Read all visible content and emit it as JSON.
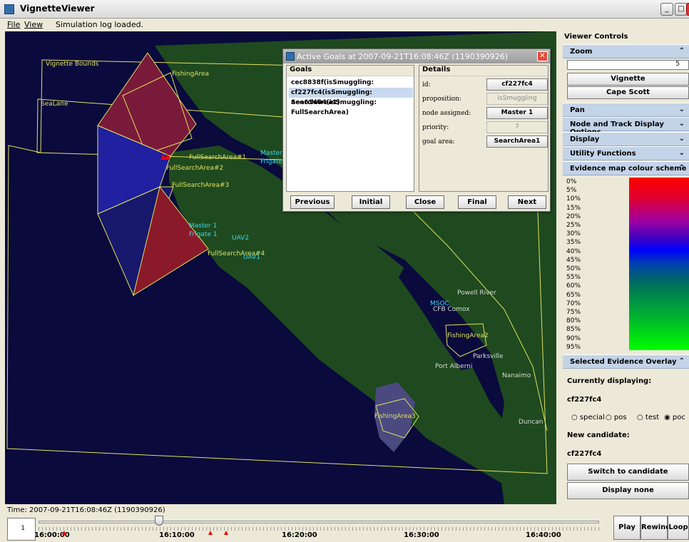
{
  "window": {
    "title": "VignetteViewer"
  },
  "menu": {
    "file": "File",
    "view": "View",
    "status": "Simulation log loaded."
  },
  "map_labels": [
    {
      "text": "Vignette Bounds",
      "cls": "zone"
    },
    {
      "text": "FishingArea",
      "cls": "zone"
    },
    {
      "text": "SeaLane",
      "cls": "zone"
    },
    {
      "text": "FullSearchArea#1",
      "cls": "zone"
    },
    {
      "text": "FullSearchArea#2",
      "cls": "zone"
    },
    {
      "text": "FullSearchArea#3",
      "cls": "zone"
    },
    {
      "text": "FullSearchArea#4",
      "cls": "zone"
    },
    {
      "text": "Master",
      "cls": "unit"
    },
    {
      "text": "Frigate",
      "cls": "unit"
    },
    {
      "text": "Master 1",
      "cls": "unit"
    },
    {
      "text": "Frigate 1",
      "cls": "unit"
    },
    {
      "text": "UAV2",
      "cls": "unit"
    },
    {
      "text": "UAV1",
      "cls": "unit"
    },
    {
      "text": "MSOC",
      "cls": "unit"
    },
    {
      "text": "CFB Comox",
      "cls": "city"
    },
    {
      "text": "Powell River",
      "cls": "city"
    },
    {
      "text": "FishingArea2",
      "cls": "zone"
    },
    {
      "text": "Parksville",
      "cls": "city"
    },
    {
      "text": "Port Alberni",
      "cls": "city"
    },
    {
      "text": "Nanaimo",
      "cls": "city"
    },
    {
      "text": "FishingArea3",
      "cls": "zone"
    },
    {
      "text": "Duncan",
      "cls": "city"
    }
  ],
  "dialog": {
    "title": "Active Goals at 2007-09-21T16:08:46Z (1190390926)",
    "goals_header": "Goals",
    "goals": [
      "cec8838f(isSmuggling: SearchArea2)",
      "cf227fc4(isSmuggling: SearchArea1)",
      "aee61494(isSmuggling: FullSearchArea)"
    ],
    "details_header": "Details",
    "details": {
      "id_label": "id:",
      "id_value": "cf227fc4",
      "proposition_label": "proposition:",
      "proposition_value": "isSmuggling",
      "node_label": "node assigned:",
      "node_value": "Master 1",
      "priority_label": "priority:",
      "priority_value": "7",
      "area_label": "goal area:",
      "area_value": "SearchArea1"
    },
    "buttons": {
      "previous": "Previous",
      "initial": "Initial",
      "close": "Close",
      "final": "Final",
      "next": "Next"
    }
  },
  "viewer": {
    "title": "Viewer Controls",
    "zoom": {
      "label": "Zoom",
      "value": "5",
      "vignette": "Vignette",
      "cape": "Cape Scott"
    },
    "sections": {
      "pan": "Pan",
      "node_track": "Node and Track Display Options",
      "display": "Display",
      "utility": "Utility Functions",
      "evidence": "Evidence map colour scheme",
      "overlay": "Selected Evidence Overlay"
    },
    "percents": [
      "0%",
      "5%",
      "10%",
      "15%",
      "20%",
      "25%",
      "30%",
      "35%",
      "40%",
      "45%",
      "50%",
      "55%",
      "60%",
      "65%",
      "70%",
      "75%",
      "80%",
      "85%",
      "90%",
      "95%"
    ],
    "overlay": {
      "currently_label": "Currently displaying:",
      "currently_value": "cf227fc4",
      "radios": [
        "special",
        "pos",
        "test",
        "poc"
      ],
      "selected_radio": "poc",
      "candidate_label": "New candidate:",
      "candidate_value": "cf227fc4",
      "switch_button": "Switch to candidate",
      "display_none_button": "Display none"
    }
  },
  "timeline": {
    "time_label": "Time: 2007-09-21T16:08:46Z (1190390926)",
    "step": "1",
    "ticks": [
      "16:00:00",
      "16:10:00",
      "16:20:00",
      "16:30:00",
      "16:40:00"
    ],
    "position": 0.215,
    "buttons": {
      "play": "Play",
      "rewind": "Rewind",
      "loop": "Loop"
    }
  }
}
